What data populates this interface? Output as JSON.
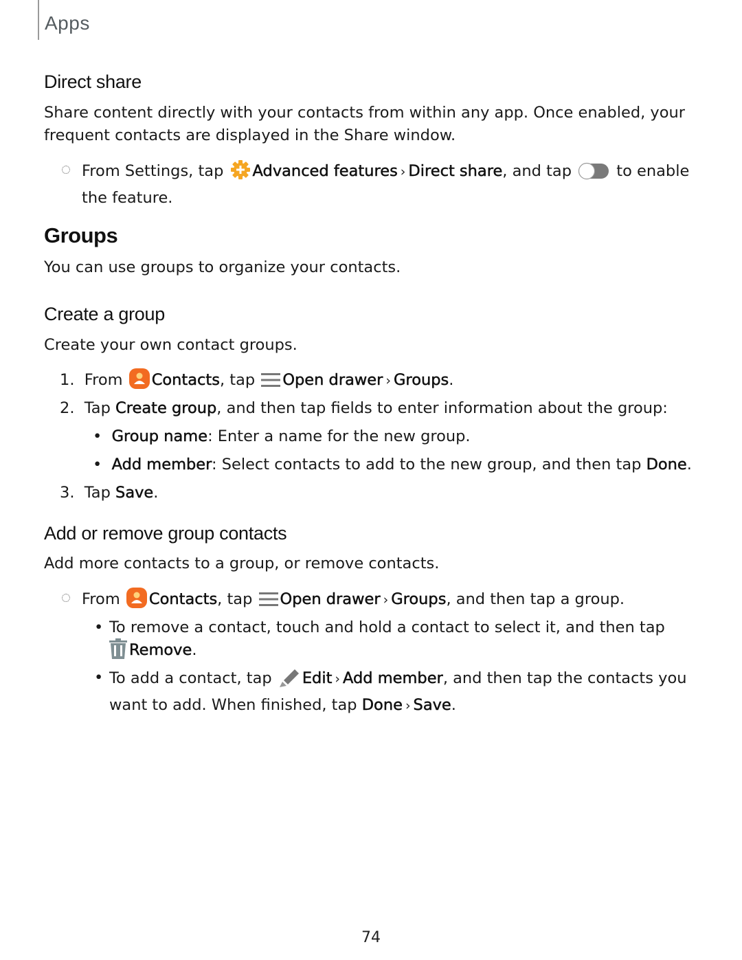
{
  "header": {
    "section": "Apps"
  },
  "direct_share": {
    "title": "Direct share",
    "intro_line1": "Share content directly with your contacts from within any app. Once enabled, your",
    "intro_line2": "frequent contacts are displayed in the Share window.",
    "step": {
      "prefix": "From Settings, tap",
      "item1": "Advanced features",
      "item2": "Direct share",
      "middle": ", and tap",
      "suffix_line1": "to enable",
      "suffix_line2": "the feature."
    }
  },
  "groups": {
    "title": "Groups",
    "intro": "You can use groups to organize your contacts."
  },
  "create_group": {
    "title": "Create a group",
    "intro": "Create your own contact groups.",
    "steps": [
      {
        "num": "1.",
        "from": "From",
        "app": "Contacts",
        "tap": ", tap",
        "drawer": "Open drawer",
        "target": "Groups",
        "end": "."
      },
      {
        "num": "2.",
        "tap": "Tap",
        "action": "Create group",
        "rest": ", and then tap fields to enter information about the group:"
      },
      {
        "num": "3.",
        "tap": "Tap",
        "action": "Save",
        "end": "."
      }
    ],
    "fields": [
      {
        "label": "Group name",
        "desc": ": Enter a name for the new group."
      },
      {
        "label": "Add member",
        "desc": ": Select contacts to add to the new group, and then tap",
        "action": "Done",
        "end": "."
      }
    ]
  },
  "add_remove": {
    "title": "Add or remove group contacts",
    "intro": "Add more contacts to a group, or remove contacts.",
    "step": {
      "from": "From",
      "app": "Contacts",
      "tap": ", tap",
      "drawer": "Open drawer",
      "target": "Groups",
      "rest": ", and then tap a group."
    },
    "bullets": [
      {
        "line1": "To remove a contact, touch and hold a contact to select it, and then tap",
        "action": "Remove",
        "end": "."
      },
      {
        "prefix": "To add a contact, tap",
        "action1": "Edit",
        "action2": "Add member",
        "rest": ", and then tap the contacts you",
        "line2_prefix": "want to add. When finished, tap",
        "action3": "Done",
        "action4": "Save",
        "end": "."
      }
    ]
  },
  "icons": {
    "advanced_features": "gear-plus-icon",
    "toggle": "toggle-switch-icon",
    "contacts": "contacts-icon",
    "drawer": "hamburger-menu-icon",
    "remove": "trash-icon",
    "edit": "pencil-icon"
  },
  "colors": {
    "advanced_features_icon": "#f5a623",
    "contacts_icon": "#f26b21",
    "trash_icon": "#7f8f93",
    "drawer_icon": "#777777"
  },
  "page_number": "74"
}
